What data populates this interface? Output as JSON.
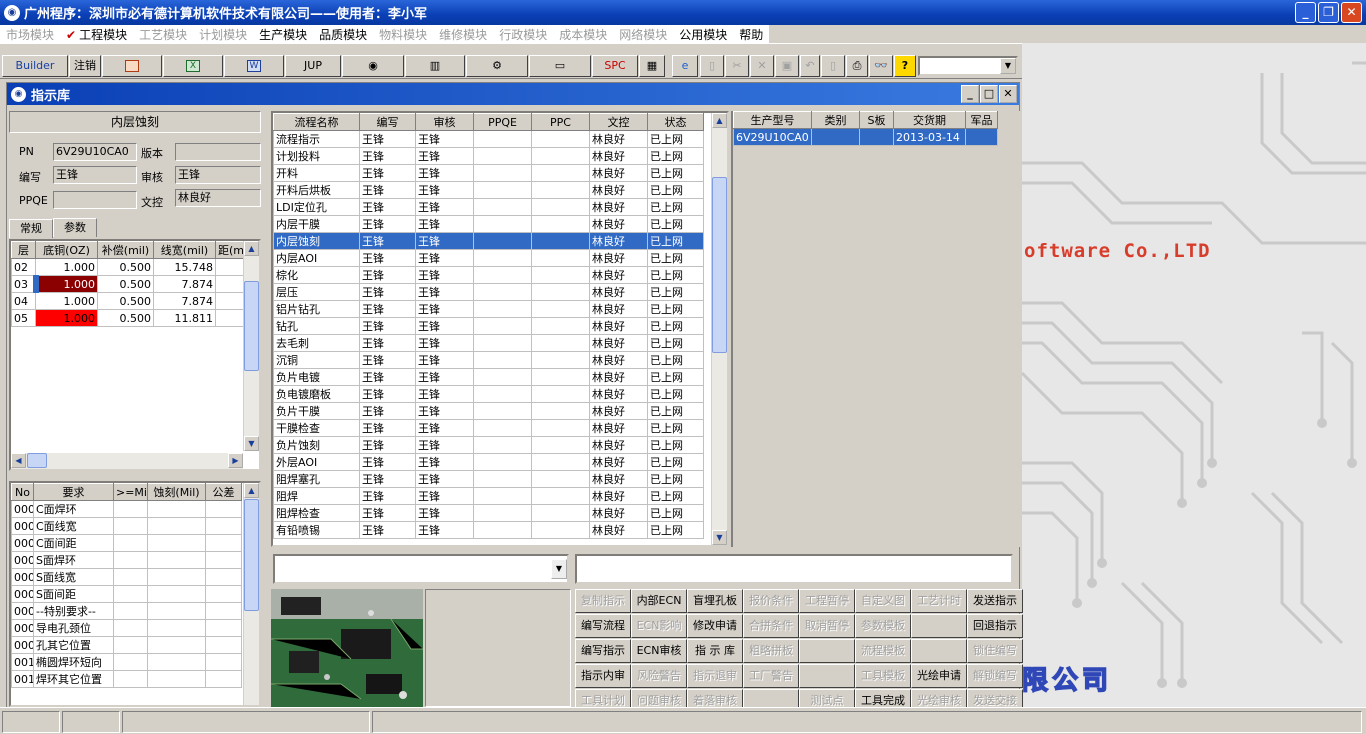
{
  "app": {
    "title": "广州程序：深圳市必有德计算机软件技术有限公司——使用者：李小军"
  },
  "menu": [
    {
      "label": "市场模块",
      "enabled": false
    },
    {
      "label": "工程模块",
      "enabled": true,
      "checked": true
    },
    {
      "label": "工艺模块",
      "enabled": false
    },
    {
      "label": "计划模块",
      "enabled": false
    },
    {
      "label": "生产模块",
      "enabled": true
    },
    {
      "label": "品质模块",
      "enabled": true
    },
    {
      "label": "物料模块",
      "enabled": false
    },
    {
      "label": "维修模块",
      "enabled": false
    },
    {
      "label": "行政模块",
      "enabled": false
    },
    {
      "label": "成本模块",
      "enabled": false
    },
    {
      "label": "网络模块",
      "enabled": false
    },
    {
      "label": "公用模块",
      "enabled": true
    },
    {
      "label": "帮助",
      "enabled": true
    }
  ],
  "toolbar": {
    "builder": "Builder",
    "logout": "注销",
    "jup": "JUP",
    "spc": "SPC",
    "w": "W"
  },
  "background": {
    "brand_text": "oftware Co.,LTD",
    "brand_cn": "限公司"
  },
  "window": {
    "title": "指示库"
  },
  "form": {
    "process_header": "内层蚀刻",
    "pn_label": "PN",
    "pn_value": "6V29U10CA0",
    "version_label": "版本",
    "version_value": "",
    "writer_label": "编写",
    "writer_value": "王锋",
    "review_label": "审核",
    "review_value": "王锋",
    "ppqe_label": "PPQE",
    "ppqe_value": "",
    "dc_label": "文控",
    "dc_value": "林良好"
  },
  "tabs": [
    {
      "label": "常规"
    },
    {
      "label": "参数"
    }
  ],
  "layer_table": {
    "headers": [
      "层",
      "底铜(OZ)",
      "补偿(mil)",
      "线宽(mil)",
      "距(mi"
    ],
    "rows": [
      [
        "02",
        "1.000",
        "0.500",
        "15.748",
        ""
      ],
      [
        "03",
        "1.000",
        "0.500",
        "7.874",
        ""
      ],
      [
        "04",
        "1.000",
        "0.500",
        "7.874",
        ""
      ],
      [
        "05",
        "1.000",
        "0.500",
        "11.811",
        ""
      ]
    ]
  },
  "req_table": {
    "headers": [
      "No",
      "要求",
      ">=Mil",
      "蚀刻(Mil)",
      "公差"
    ],
    "rows": [
      [
        "000",
        "C面焊环"
      ],
      [
        "000",
        "C面线宽"
      ],
      [
        "000",
        "C面间距"
      ],
      [
        "000",
        "S面焊环"
      ],
      [
        "000",
        "S面线宽"
      ],
      [
        "000",
        "S面间距"
      ],
      [
        "000",
        "--特别要求--"
      ],
      [
        "000",
        "导电孔颈位"
      ],
      [
        "000",
        "孔其它位置"
      ],
      [
        "001",
        "椭圆焊环短向"
      ],
      [
        "001",
        "焊环其它位置"
      ]
    ]
  },
  "process_table": {
    "headers": [
      "流程名称",
      "编写",
      "审核",
      "PPQE",
      "PPC",
      "文控",
      "状态"
    ],
    "selected_index": 6,
    "rows": [
      [
        "流程指示",
        "王锋",
        "王锋",
        "",
        "",
        "林良好",
        "已上网"
      ],
      [
        "计划投料",
        "王锋",
        "王锋",
        "",
        "",
        "林良好",
        "已上网"
      ],
      [
        "开料",
        "王锋",
        "王锋",
        "",
        "",
        "林良好",
        "已上网"
      ],
      [
        "开料后烘板",
        "王锋",
        "王锋",
        "",
        "",
        "林良好",
        "已上网"
      ],
      [
        "LDI定位孔",
        "王锋",
        "王锋",
        "",
        "",
        "林良好",
        "已上网"
      ],
      [
        "内层干膜",
        "王锋",
        "王锋",
        "",
        "",
        "林良好",
        "已上网"
      ],
      [
        "内层蚀刻",
        "王锋",
        "王锋",
        "",
        "",
        "林良好",
        "已上网"
      ],
      [
        "内层AOI",
        "王锋",
        "王锋",
        "",
        "",
        "林良好",
        "已上网"
      ],
      [
        "棕化",
        "王锋",
        "王锋",
        "",
        "",
        "林良好",
        "已上网"
      ],
      [
        "层压",
        "王锋",
        "王锋",
        "",
        "",
        "林良好",
        "已上网"
      ],
      [
        "铝片钻孔",
        "王锋",
        "王锋",
        "",
        "",
        "林良好",
        "已上网"
      ],
      [
        "钻孔",
        "王锋",
        "王锋",
        "",
        "",
        "林良好",
        "已上网"
      ],
      [
        "去毛刺",
        "王锋",
        "王锋",
        "",
        "",
        "林良好",
        "已上网"
      ],
      [
        "沉铜",
        "王锋",
        "王锋",
        "",
        "",
        "林良好",
        "已上网"
      ],
      [
        "负片电镀",
        "王锋",
        "王锋",
        "",
        "",
        "林良好",
        "已上网"
      ],
      [
        "负电镀磨板",
        "王锋",
        "王锋",
        "",
        "",
        "林良好",
        "已上网"
      ],
      [
        "负片干膜",
        "王锋",
        "王锋",
        "",
        "",
        "林良好",
        "已上网"
      ],
      [
        "干膜检查",
        "王锋",
        "王锋",
        "",
        "",
        "林良好",
        "已上网"
      ],
      [
        "负片蚀刻",
        "王锋",
        "王锋",
        "",
        "",
        "林良好",
        "已上网"
      ],
      [
        "外层AOI",
        "王锋",
        "王锋",
        "",
        "",
        "林良好",
        "已上网"
      ],
      [
        "阻焊塞孔",
        "王锋",
        "王锋",
        "",
        "",
        "林良好",
        "已上网"
      ],
      [
        "阻焊",
        "王锋",
        "王锋",
        "",
        "",
        "林良好",
        "已上网"
      ],
      [
        "阻焊检查",
        "王锋",
        "王锋",
        "",
        "",
        "林良好",
        "已上网"
      ],
      [
        "有铅喷锡",
        "王锋",
        "王锋",
        "",
        "",
        "林良好",
        "已上网"
      ]
    ]
  },
  "product_table": {
    "headers": [
      "生产型号",
      "类别",
      "S板",
      "交货期",
      "军品"
    ],
    "rows": [
      [
        "6V29U10CA0",
        "",
        "",
        "2013-03-14",
        ""
      ]
    ]
  },
  "action_buttons": [
    [
      "复制指示",
      "内部ECN",
      "盲埋孔板",
      "报价条件",
      "工程暂停",
      "自定义图",
      "工艺计时",
      "发送指示"
    ],
    [
      "编写流程",
      "ECN影响",
      "修改申请",
      "合拼条件",
      "取消暂停",
      "参数模板",
      "",
      "回退指示"
    ],
    [
      "编写指示",
      "ECN审核",
      "指 示 库",
      "粗略拼板",
      "",
      "流程模板",
      "",
      "锁住编写"
    ],
    [
      "指示内审",
      "风险警告",
      "指示退审",
      "工厂警告",
      "",
      "工具模板",
      "光绘申请",
      "解锁编写"
    ],
    [
      "工具计划",
      "问题审核",
      "着落审核",
      "",
      "测试点",
      "工具完成",
      "光绘审核",
      "发送交接"
    ]
  ],
  "action_enabled": [
    [
      false,
      true,
      true,
      false,
      false,
      false,
      false,
      true
    ],
    [
      true,
      false,
      true,
      false,
      false,
      false,
      false,
      true
    ],
    [
      true,
      true,
      true,
      false,
      false,
      false,
      false,
      false
    ],
    [
      true,
      false,
      false,
      false,
      false,
      false,
      true,
      false
    ],
    [
      false,
      false,
      false,
      false,
      false,
      true,
      false,
      false
    ]
  ]
}
